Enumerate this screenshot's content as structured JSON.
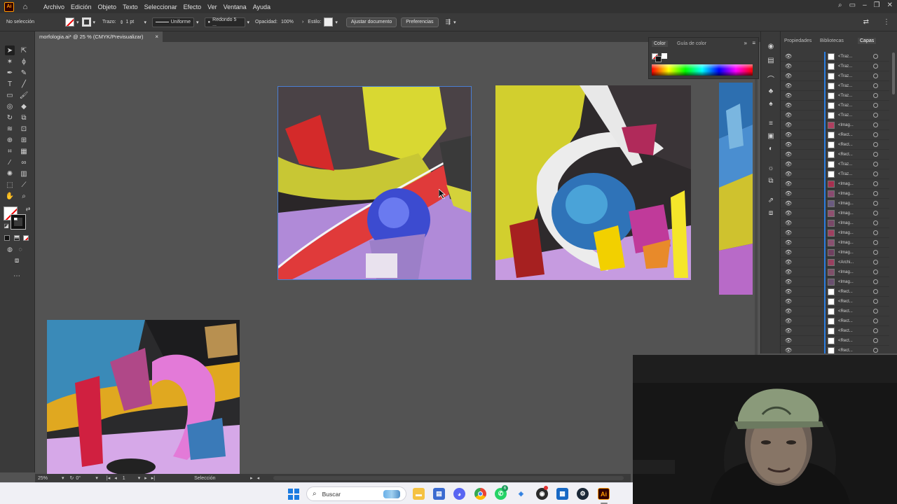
{
  "app": {
    "logo_text": "Ai",
    "menu": [
      "Archivo",
      "Edición",
      "Objeto",
      "Texto",
      "Seleccionar",
      "Efecto",
      "Ver",
      "Ventana",
      "Ayuda"
    ]
  },
  "control_bar": {
    "selection_status": "No selección",
    "stroke_label": "Trazo:",
    "stroke_weight": "1 pt",
    "stroke_profile": "Uniforme",
    "brush": "Redondo 5 ...",
    "opacity_label": "Opacidad:",
    "opacity_value": "100%",
    "style_label": "Estilo:",
    "fit_document_button": "Ajustar documento",
    "preferences_button": "Preferencias"
  },
  "document_tab": {
    "title": "morfologia.ai* @ 25 % (CMYK/Previsualizar)",
    "close": "×"
  },
  "color_panel": {
    "tabs": [
      "Color",
      "Guía de color"
    ]
  },
  "layers_panel": {
    "tabs": [
      "Propiedades",
      "Bibliotecas",
      "Capas"
    ],
    "rows": [
      {
        "name": "<Traz...",
        "thumb": "#ffffff"
      },
      {
        "name": "<Traz...",
        "thumb": "#ffffff"
      },
      {
        "name": "<Traz...",
        "thumb": "#ffffff"
      },
      {
        "name": "<Traz...",
        "thumb": "#ffffff"
      },
      {
        "name": "<Traz...",
        "thumb": "#ffffff"
      },
      {
        "name": "<Traz...",
        "thumb": "#ffffff"
      },
      {
        "name": "<Traz...",
        "thumb": "#ffffff"
      },
      {
        "name": "<Imag...",
        "thumb": "#b04060"
      },
      {
        "name": "<Rect...",
        "thumb": "#ffffff"
      },
      {
        "name": "<Rect...",
        "thumb": "#ffffff"
      },
      {
        "name": "<Rect...",
        "thumb": "#ffffff"
      },
      {
        "name": "<Traz...",
        "thumb": "#ffffff"
      },
      {
        "name": "<Traz...",
        "thumb": "#ffffff"
      },
      {
        "name": "<Imag...",
        "thumb": "#a83050"
      },
      {
        "name": "<Imag...",
        "thumb": "#8a4a70"
      },
      {
        "name": "<Imag...",
        "thumb": "#6a5a80"
      },
      {
        "name": "<Imag...",
        "thumb": "#905070"
      },
      {
        "name": "<Imag...",
        "thumb": "#7a4868"
      },
      {
        "name": "<Imag...",
        "thumb": "#a04060"
      },
      {
        "name": "<Imag...",
        "thumb": "#8a5070"
      },
      {
        "name": "<Imag...",
        "thumb": "#704060"
      },
      {
        "name": "<Archi...",
        "thumb": "#9a4060"
      },
      {
        "name": "<Imag...",
        "thumb": "#80506a"
      },
      {
        "name": "<Imag...",
        "thumb": "#6a5070"
      },
      {
        "name": "<Rect...",
        "thumb": "#ffffff"
      },
      {
        "name": "<Rect...",
        "thumb": "#ffffff"
      },
      {
        "name": "<Rect...",
        "thumb": "#ffffff"
      },
      {
        "name": "<Rect...",
        "thumb": "#ffffff"
      },
      {
        "name": "<Rect...",
        "thumb": "#ffffff"
      },
      {
        "name": "<Rect...",
        "thumb": "#ffffff"
      },
      {
        "name": "<Rect...",
        "thumb": "#ffffff"
      }
    ]
  },
  "status_bar": {
    "zoom": "25%",
    "rotation": "0°",
    "artboard_number": "1",
    "tool_name": "Selección"
  },
  "taskbar": {
    "search_placeholder": "Buscar",
    "whatsapp_badge": "6"
  },
  "colors": {
    "accent_blue": "#2a7de1",
    "illustrator_orange": "#ff9a00",
    "panel_bg": "#3a3a3a",
    "canvas_bg": "#535353"
  }
}
